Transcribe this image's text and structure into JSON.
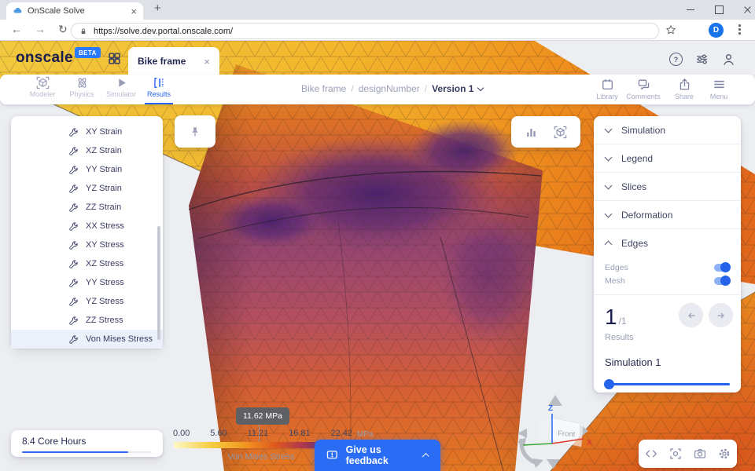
{
  "browser": {
    "tab_title": "OnScale Solve",
    "url": "https://solve.dev.portal.onscale.com/",
    "avatar_letter": "D"
  },
  "icons": {
    "close": "×",
    "help": "?",
    "plus": "+"
  },
  "header": {
    "logo": "onscale",
    "beta_badge": "BETA",
    "doc_tab": "Bike frame"
  },
  "nav": {
    "items": [
      {
        "label": "Modeler"
      },
      {
        "label": "Physics"
      },
      {
        "label": "Simulator"
      },
      {
        "label": "Results"
      }
    ],
    "active": "Results"
  },
  "breadcrumb": {
    "project": "Bike frame",
    "separator": "/",
    "design": "designNumber",
    "version": "Version 1"
  },
  "header_actions": {
    "library": "Library",
    "comments": "Comments",
    "share": "Share",
    "menu": "Menu"
  },
  "results_list": {
    "items": [
      "XY Strain",
      "XZ Strain",
      "YY Strain",
      "YZ Strain",
      "ZZ Strain",
      "XX Stress",
      "XY Stress",
      "XZ Stress",
      "YY Stress",
      "YZ Stress",
      "ZZ Stress",
      "Von Mises Stress"
    ],
    "selected": "Von Mises Stress"
  },
  "right_panel": {
    "sections": [
      "Simulation",
      "Legend",
      "Slices",
      "Deformation",
      "Edges"
    ],
    "edges_controls": [
      {
        "label": "Edges",
        "on": true
      },
      {
        "label": "Mesh",
        "on": true
      }
    ],
    "pager": {
      "current": "1",
      "total": "/1",
      "caption": "Results"
    },
    "simulation_label": "Simulation 1"
  },
  "core_hours": {
    "label": "8.4 Core Hours",
    "progress_percent": 82
  },
  "legend": {
    "tooltip": "11.62 MPa",
    "ticks": [
      "0.00",
      "5.60",
      "11.21",
      "16.81",
      "22.42"
    ],
    "unit": "MPa",
    "label": "Von Mises Stress"
  },
  "feedback": {
    "label": "Give us feedback"
  },
  "nav_cube": {
    "front": "Front",
    "z": "Z",
    "x": "X"
  },
  "colors": {
    "accent": "#2a63f5",
    "beta_badge": "#2979ff",
    "selected_row": "#ecf0fa",
    "legend_gradient": [
      "#fcf8c6",
      "#f6cb3e",
      "#f0921f",
      "#de5a1d",
      "#b43a4a",
      "#7a2f63",
      "#1f1a36"
    ]
  }
}
